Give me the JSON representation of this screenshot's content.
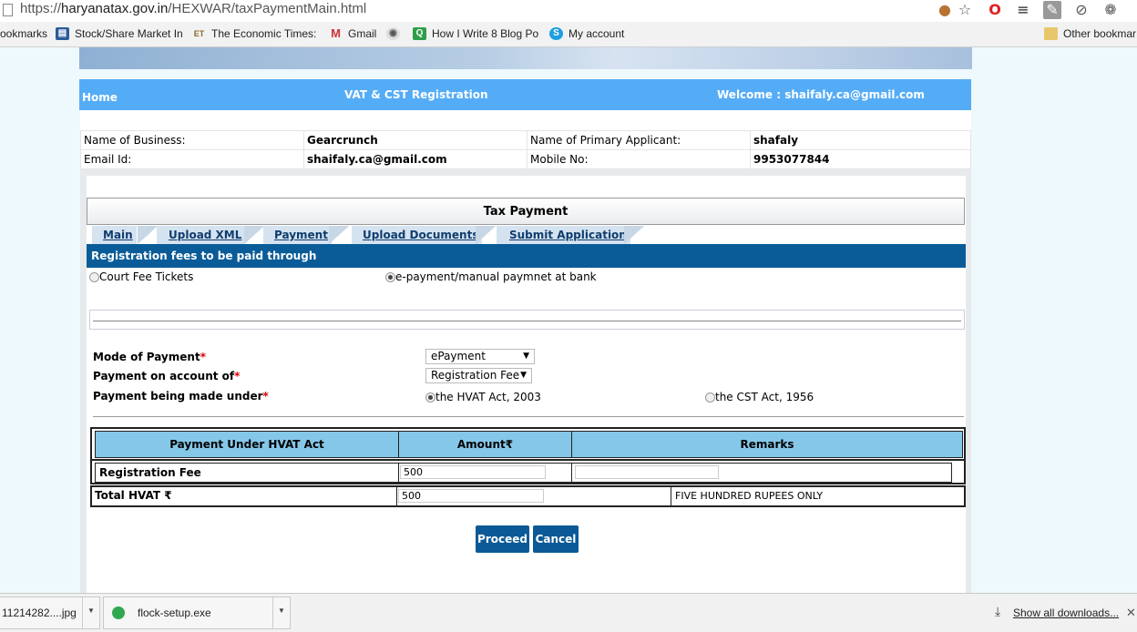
{
  "browser": {
    "url_scheme": "https://",
    "url_host": "haryanatax.gov.in",
    "url_path": "/HEXWAR/taxPaymentMain.html",
    "toolbar_icons": [
      "adblock-icon",
      "star-icon",
      "opera-icon",
      "layers-icon",
      "wrench-icon",
      "disabled-icon",
      "settings-icon"
    ],
    "bookmarks": [
      {
        "label": "ookmarks",
        "icon": "none"
      },
      {
        "label": "Stock/Share Market In",
        "icon": "stock-icon"
      },
      {
        "label": "The Economic Times:",
        "icon": "et-icon"
      },
      {
        "label": "Gmail",
        "icon": "gmail-icon"
      },
      {
        "label": "",
        "icon": "globe-icon"
      },
      {
        "label": "How I Write 8 Blog Po",
        "icon": "q-icon"
      },
      {
        "label": "My account",
        "icon": "skype-icon"
      }
    ],
    "other_bookmarks": "Other bookmar"
  },
  "nav": {
    "home": "Home",
    "title": "VAT & CST Registration",
    "welcome": "Welcome : shaifaly.ca@gmail.com"
  },
  "info": {
    "business_label": "Name of Business:",
    "business_value": "Gearcrunch",
    "applicant_label": "Name of Primary Applicant:",
    "applicant_value": "shafaly",
    "email_label": "Email Id:",
    "email_value": "shaifaly.ca@gmail.com",
    "mobile_label": "Mobile No:",
    "mobile_value": "9953077844"
  },
  "tax_payment": {
    "heading": "Tax Payment",
    "tabs": [
      "Main",
      "Upload XML",
      "Payment",
      "Upload Documents",
      "Submit Application"
    ],
    "reg_bar": "Registration fees to be paid through",
    "option_court": "Court Fee Tickets",
    "option_epay": "e-payment/manual paymnet at bank",
    "selected_option": "e-payment/manual paymnet at bank"
  },
  "form": {
    "mode_label": "Mode of Payment",
    "mode_value": "ePayment",
    "account_label": "Payment on account of",
    "account_value": "Registration Fee",
    "under_label": "Payment being made under",
    "under_hvat": "the HVAT Act, 2003",
    "under_cst": "the CST Act, 1956",
    "required_mark": "*"
  },
  "table": {
    "col1": "Payment Under HVAT Act",
    "col2": "Amount₹",
    "col3": "Remarks",
    "row_label": "Registration Fee",
    "row_amount": "500",
    "row_remarks": "",
    "total_label": "Total HVAT ₹",
    "total_amount": "500",
    "total_words": "FIVE HUNDRED RUPEES ONLY"
  },
  "buttons": {
    "proceed": "Proceed",
    "cancel": "Cancel"
  },
  "downloads": {
    "items": [
      "11214282....jpg",
      "flock-setup.exe"
    ],
    "show_all": "Show all downloads..."
  },
  "colors": {
    "nav_blue": "#55acf6",
    "dark_blue": "#0a5c98",
    "table_header": "#85c7e8"
  }
}
